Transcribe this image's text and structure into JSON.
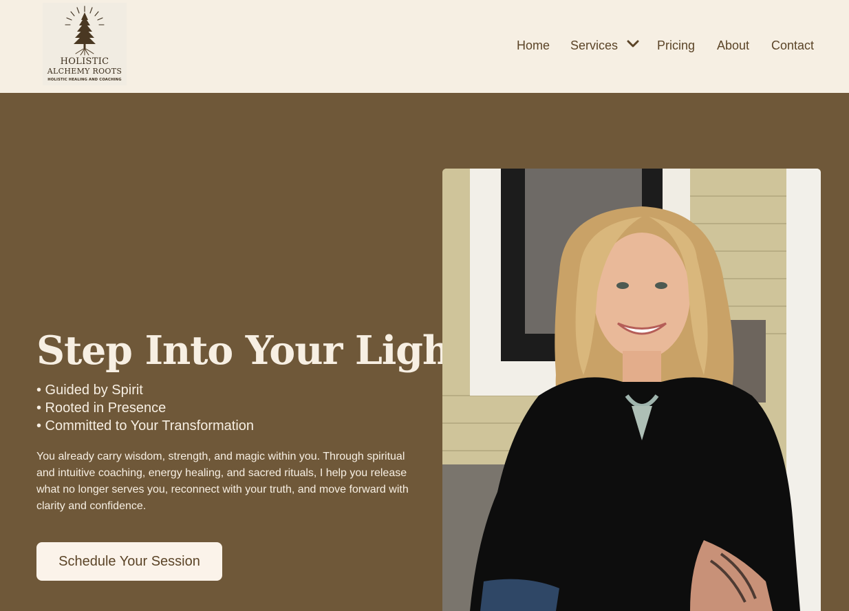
{
  "brand": {
    "name_line1": "HOLISTIC",
    "name_line2": "ALCHEMY ROOTS",
    "tagline": "HOLISTIC HEALING AND COACHING"
  },
  "nav": {
    "items": [
      {
        "label": "Home"
      },
      {
        "label": "Services"
      },
      {
        "label": "Pricing"
      },
      {
        "label": "About"
      },
      {
        "label": "Contact"
      }
    ]
  },
  "hero": {
    "title": "Step Into Your Light",
    "bullets": [
      "• Guided by Spirit",
      "• Rooted in Presence",
      "• Committed to Your Transformation"
    ],
    "description": "You already carry wisdom, strength, and magic within you. Through spiritual and intuitive coaching, energy healing, and sacred rituals, I help you release what no longer serves you, reconnect with your truth, and move forward with clarity and confidence.",
    "cta_label": "Schedule Your Session"
  },
  "colors": {
    "header_bg": "#f6efe3",
    "hero_bg": "#6f5839",
    "nav_text": "#5b4427",
    "hero_text": "#f7efe3",
    "button_bg": "#fbf3ea"
  },
  "icons": {
    "logo_mark": "pine-tree-sunburst-icon",
    "services_dropdown": "chevron-down-icon"
  }
}
